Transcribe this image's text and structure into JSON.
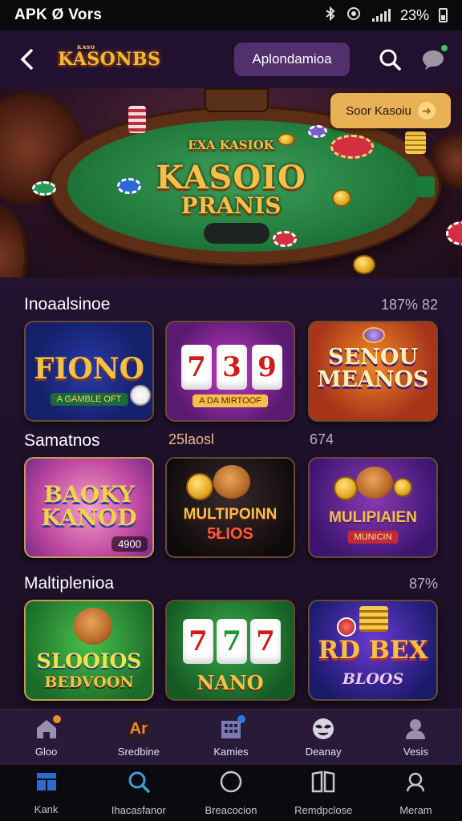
{
  "status_bar": {
    "app_label": "APK Ø Vors",
    "battery": "23%"
  },
  "header": {
    "logo_text": "KASONBS",
    "logo_small": "ᴋᴀsᴏ",
    "action_button": "Aplondamioa"
  },
  "hero": {
    "subtitle": "EXA KASIOK",
    "title_line1": "KASOIO",
    "title_line2": "PRANIS",
    "promo_label": "Soor Kasoiu",
    "promo_arrow": "➜"
  },
  "sections": [
    {
      "title": "Inoaalsinoe",
      "meta": "187% 82",
      "tiles": [
        {
          "title": "FIONO",
          "sub": "A GAMBLE OFT"
        },
        {
          "title": "739",
          "sub": "A DA MIRTOOF"
        },
        {
          "title": "SENOU MEANOS",
          "sub": ""
        }
      ]
    },
    {
      "title": "Samatnos",
      "meta_mid": "25laosl",
      "meta": "674",
      "tiles": [
        {
          "title": "BAOKY KANOD",
          "badge": "4900"
        },
        {
          "title": "MULTIPOINN",
          "sub": "5ŁIOS"
        },
        {
          "title": "MULIPIAIEN",
          "sub": "MUNICIN"
        }
      ]
    },
    {
      "title": "Maltiplenioa",
      "meta": "87%",
      "tiles": [
        {
          "title": "SLOOIOS",
          "sub": "BEDVOON"
        },
        {
          "title": "NANO",
          "sub": "777"
        },
        {
          "title": "RD BEX",
          "sub": "BLOOS"
        }
      ]
    }
  ],
  "subnav": [
    {
      "label": "Gloo",
      "icon": "home-icon"
    },
    {
      "label": "Sredbine",
      "icon": "ai-icon",
      "glyph": "Ar"
    },
    {
      "label": "Kamies",
      "icon": "building-icon"
    },
    {
      "label": "Deanay",
      "icon": "mask-icon"
    },
    {
      "label": "Vesis",
      "icon": "user-icon"
    }
  ],
  "bottomnav": [
    {
      "label": "Kank",
      "icon": "home-block-icon"
    },
    {
      "label": "Ihacasfanor",
      "icon": "search-icon"
    },
    {
      "label": "Breacocion",
      "icon": "circle-icon"
    },
    {
      "label": "Remdpclose",
      "icon": "book-icon"
    },
    {
      "label": "Meram",
      "icon": "profile-icon"
    }
  ],
  "colors": {
    "accent_gold": "#f5c04a",
    "action_button_bg": "#51306b",
    "promo_bg": "#e8b155",
    "bottom_active": "#3a8ad6"
  }
}
